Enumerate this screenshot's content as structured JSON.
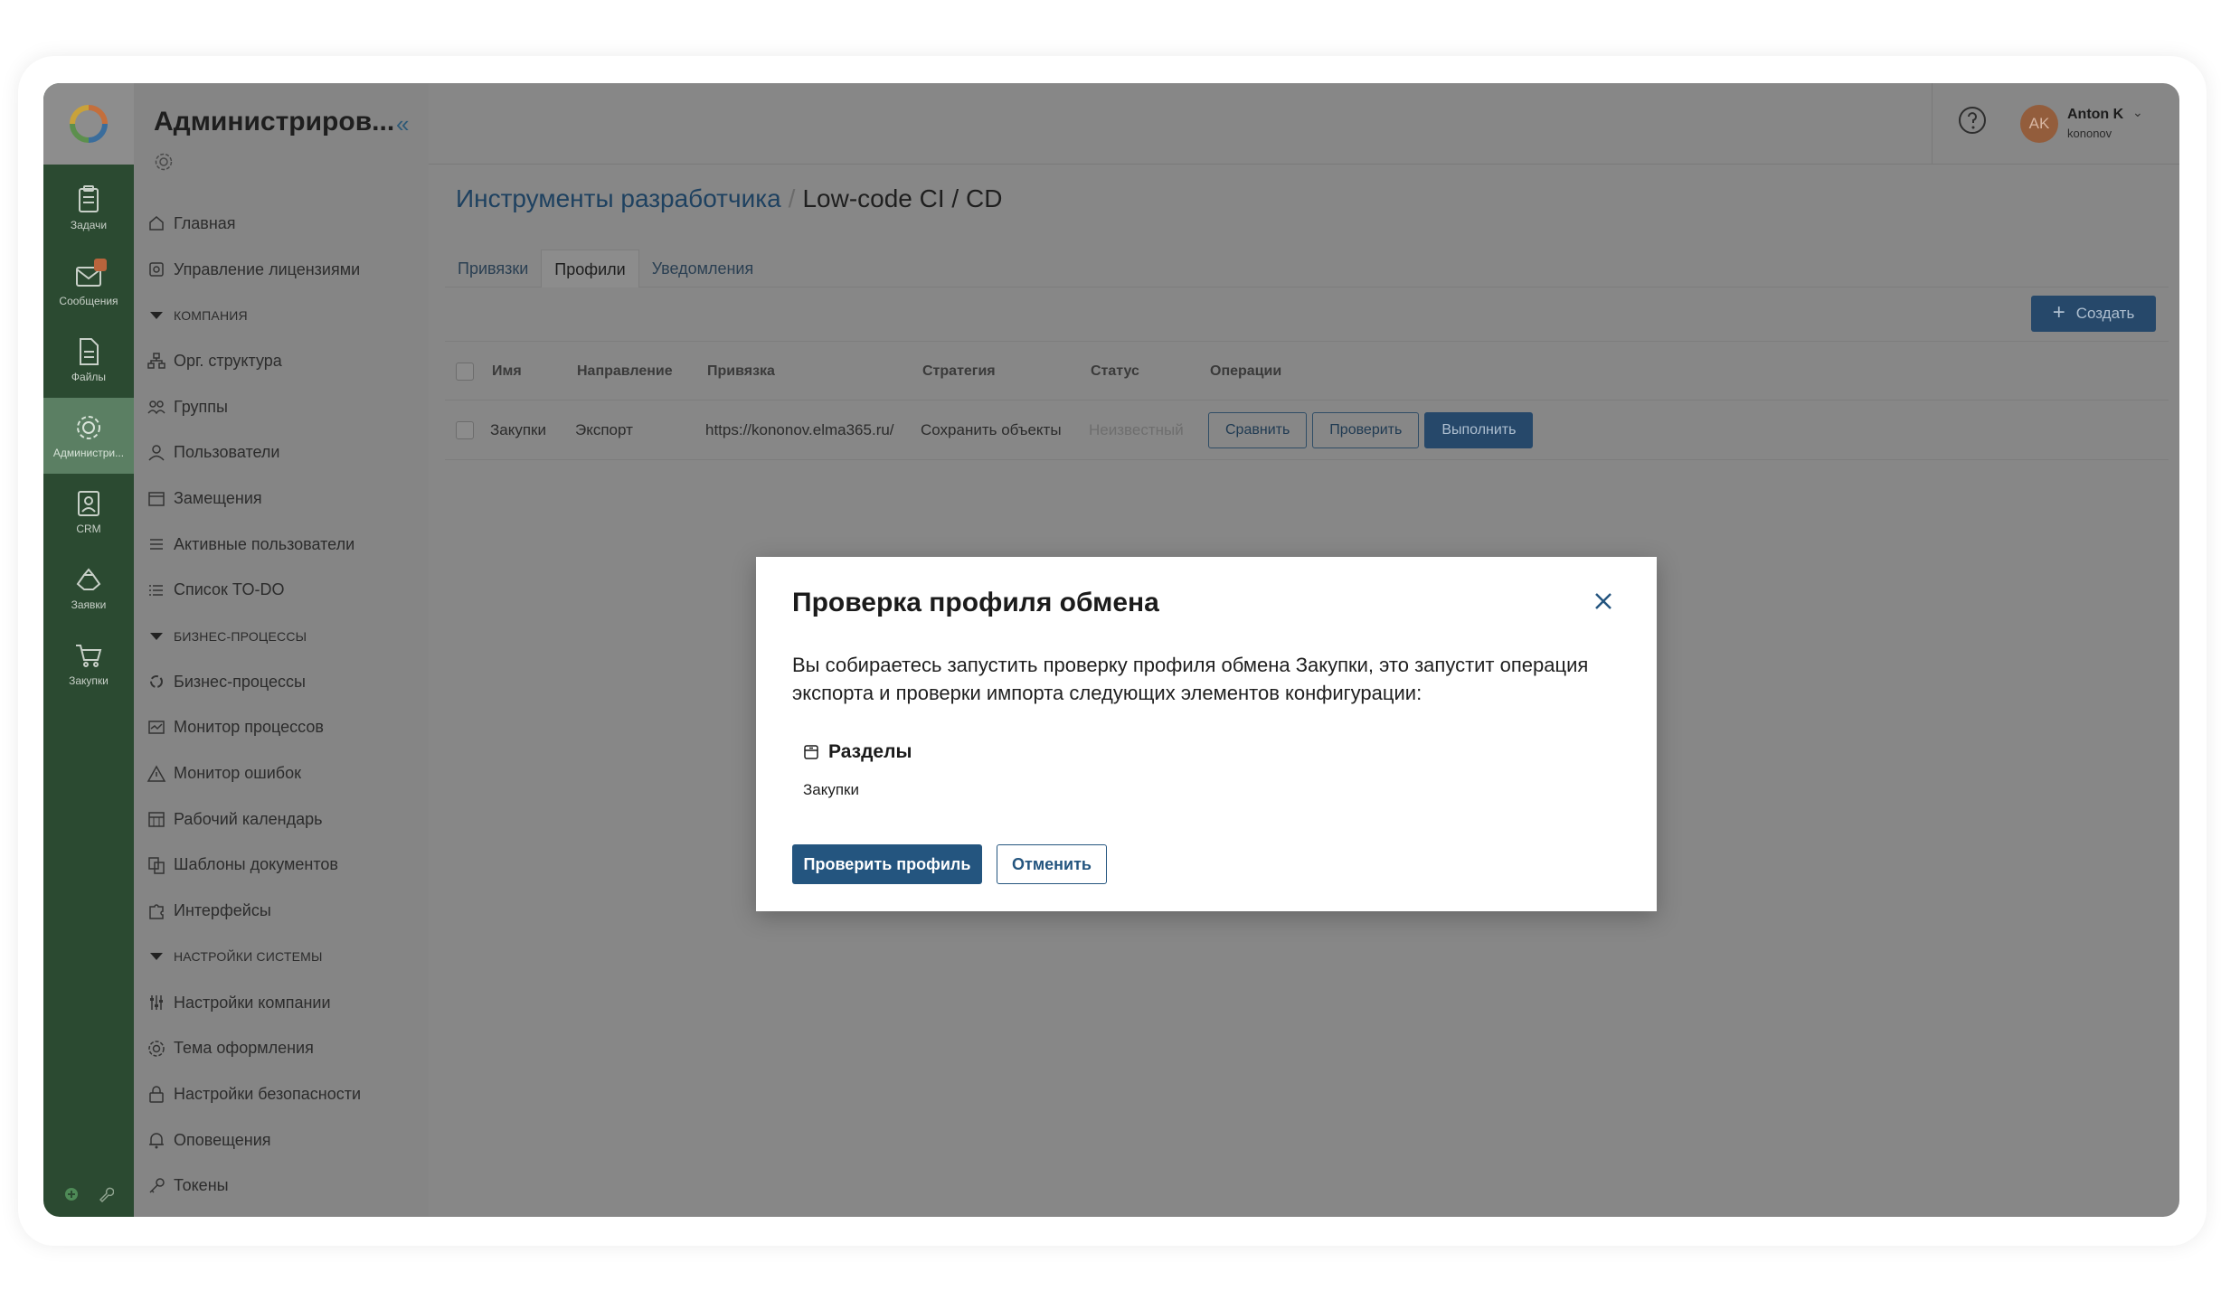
{
  "rail": {
    "items": [
      {
        "label": "Задачи",
        "icon": "tasks-icon"
      },
      {
        "label": "Сообщения",
        "icon": "messages-icon"
      },
      {
        "label": "Файлы",
        "icon": "files-icon"
      },
      {
        "label": "Администри...",
        "icon": "admin-gear-icon"
      },
      {
        "label": "CRM",
        "icon": "crm-icon"
      },
      {
        "label": "Заявки",
        "icon": "requests-icon"
      },
      {
        "label": "Закупки",
        "icon": "cart-icon"
      }
    ]
  },
  "nav": {
    "title": "Администриров...",
    "items": [
      {
        "label": "Главная"
      },
      {
        "label": "Управление лицензиями"
      },
      {
        "section": "КОМПАНИЯ"
      },
      {
        "label": "Орг. структура"
      },
      {
        "label": "Группы"
      },
      {
        "label": "Пользователи"
      },
      {
        "label": "Замещения"
      },
      {
        "label": "Активные пользователи"
      },
      {
        "label": "Список TO-DO"
      },
      {
        "section": "БИЗНЕС-ПРОЦЕССЫ"
      },
      {
        "label": "Бизнес-процессы"
      },
      {
        "label": "Монитор процессов"
      },
      {
        "label": "Монитор ошибок"
      },
      {
        "label": "Рабочий календарь"
      },
      {
        "label": "Шаблоны документов"
      },
      {
        "label": "Интерфейсы"
      },
      {
        "section": "НАСТРОЙКИ СИСТЕМЫ"
      },
      {
        "label": "Настройки компании"
      },
      {
        "label": "Тема оформления"
      },
      {
        "label": "Настройки безопасности"
      },
      {
        "label": "Оповещения"
      },
      {
        "label": "Токены"
      }
    ]
  },
  "user": {
    "initials": "AK",
    "name": "Anton K",
    "login": "kononov"
  },
  "breadcrumb": {
    "parent": "Инструменты разработчика",
    "separator": "/",
    "current": "Low-code CI / CD"
  },
  "tabs": [
    "Привязки",
    "Профили",
    "Уведомления"
  ],
  "create_label": "Создать",
  "table": {
    "headers": [
      "Имя",
      "Направление",
      "Привязка",
      "Стратегия",
      "Статус",
      "Операции"
    ],
    "rows": [
      {
        "name": "Закупки",
        "direction": "Экспорт",
        "binding": "https://kononov.elma365.ru/",
        "strategy": "Сохранить объекты",
        "status": "Неизвестный",
        "ops": [
          "Сравнить",
          "Проверить",
          "Выполнить"
        ]
      }
    ]
  },
  "modal": {
    "title": "Проверка профиля обмена",
    "text": "Вы собираетесь запустить проверку профиля обмена Закупки, это запустит операция экспорта и проверки импорта следующих элементов конфигурации:",
    "section_title": "Разделы",
    "section_item": "Закупки",
    "confirm_label": "Проверить профиль",
    "cancel_label": "Отменить"
  }
}
